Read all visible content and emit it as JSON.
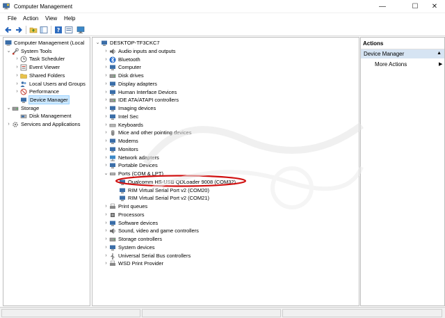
{
  "window": {
    "title": "Computer Management",
    "controls": {
      "minimize": "—",
      "maximize": "☐",
      "close": "✕"
    }
  },
  "menu": {
    "file": "File",
    "action": "Action",
    "view": "View",
    "help": "Help"
  },
  "toolbar": {
    "icons": [
      "back-icon",
      "forward-icon",
      "folder-up-icon",
      "console-tree-icon",
      "help-icon",
      "properties-icon",
      "monitor-icon"
    ]
  },
  "left_tree": {
    "root": "Computer Management (Local",
    "system_tools": "System Tools",
    "task_scheduler": "Task Scheduler",
    "event_viewer": "Event Viewer",
    "shared_folders": "Shared Folders",
    "local_users": "Local Users and Groups",
    "performance": "Performance",
    "device_manager": "Device Manager",
    "storage": "Storage",
    "disk_management": "Disk Management",
    "services": "Services and Applications"
  },
  "device_tree": {
    "computer": "DESKTOP-TF3CKC7",
    "categories": [
      "Audio inputs and outputs",
      "Bluetooth",
      "Computer",
      "Disk drives",
      "Display adapters",
      "Human Interface Devices",
      "IDE ATA/ATAPI controllers",
      "Imaging devices",
      "Intel Sec",
      "Keyboards",
      "Mice and other pointing devices",
      "Modems",
      "Monitors",
      "Network adapters",
      "Portable Devices",
      "Ports (COM & LPT)"
    ],
    "ports": [
      "Qualcomm HS-USB QDLoader 9008 (COM32)",
      "RIM Virtual Serial Port v2 (COM20)",
      "RIM Virtual Serial Port v2 (COM21)"
    ],
    "categories_after": [
      "Print queues",
      "Processors",
      "Software devices",
      "Sound, video and game controllers",
      "Storage controllers",
      "System devices",
      "Universal Serial Bus controllers",
      "WSD Print Provider"
    ]
  },
  "actions": {
    "header": "Actions",
    "section": "Device Manager",
    "more": "More Actions"
  },
  "colors": {
    "selection": "#cce8ff",
    "actions_header_bg": "#d6e4f3",
    "highlight_ring": "#d01010"
  }
}
